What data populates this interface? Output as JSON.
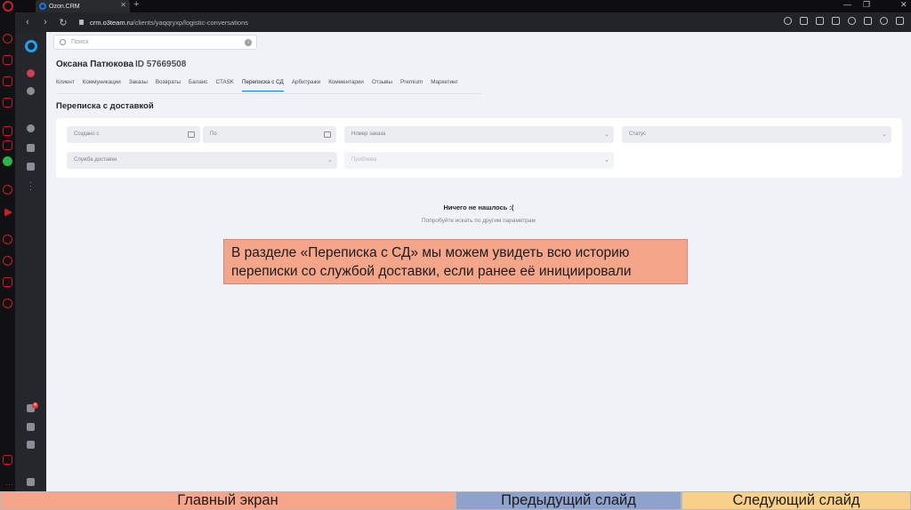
{
  "browser": {
    "tab_title": "Ozon.CRM",
    "url_host": "crm.o3team.ru",
    "url_path": "/clients/yaqqryxp/logistic-conversations"
  },
  "search": {
    "placeholder": "Поиск"
  },
  "client": {
    "name": "Оксана Патюкова",
    "id": "ID 57669508"
  },
  "tabs": [
    {
      "label": "Клиент"
    },
    {
      "label": "Коммуникации"
    },
    {
      "label": "Заказы"
    },
    {
      "label": "Возвраты"
    },
    {
      "label": "Баланс"
    },
    {
      "label": "CTASK"
    },
    {
      "label": "Переписка с СД",
      "active": true
    },
    {
      "label": "Арбитражи"
    },
    {
      "label": "Комментарии"
    },
    {
      "label": "Отзывы"
    },
    {
      "label": "Premium"
    },
    {
      "label": "Маркетинг"
    }
  ],
  "section_title": "Переписка с доставкой",
  "filters": {
    "created_from": "Создано с",
    "to": "По",
    "order_number": "Номер заказа",
    "status": "Статус",
    "delivery_service": "Служба доставки",
    "problem": "Проблема"
  },
  "empty_state": {
    "title": "Ничего не нашлось :(",
    "subtitle": "Попробуйте искать по другим параметрам"
  },
  "notifications_badge": "4",
  "callout_text": "В разделе «Переписка с СД» мы можем увидеть всю историю переписки со службой доставки, если ранее её инициировали",
  "bottom_nav": {
    "home": "Главный экран",
    "prev": "Предыдущий слайд",
    "next": "Следующий слайд"
  },
  "colors": {
    "accent": "#1a73e8",
    "callout_bg": "#f4a58a",
    "nav_home_bg": "#f4a58a",
    "nav_prev_bg": "#8ea2cc",
    "nav_next_bg": "#f8d08a"
  }
}
